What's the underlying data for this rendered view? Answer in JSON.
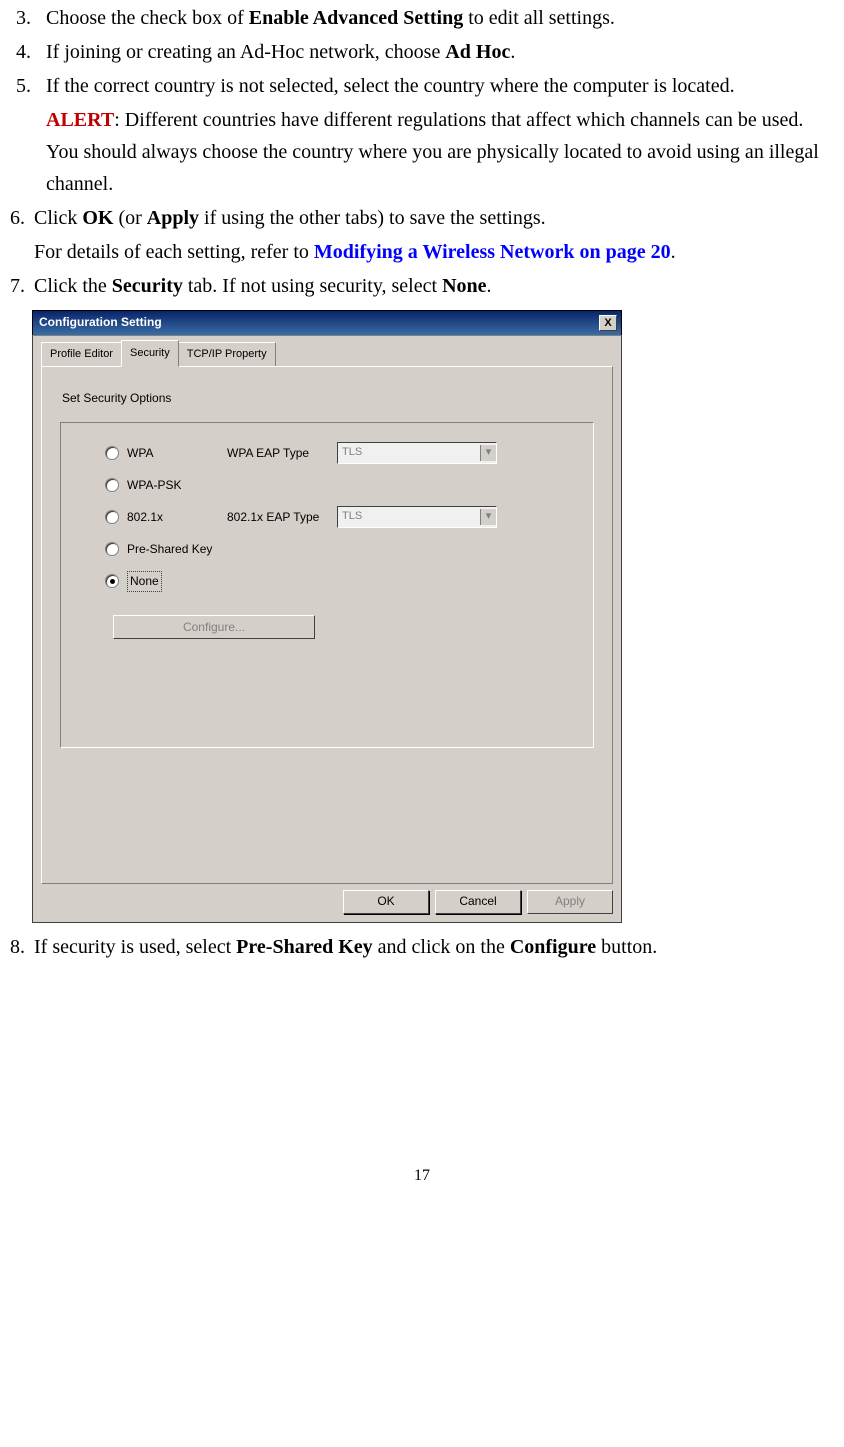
{
  "steps": {
    "s3": {
      "num": "3.",
      "text_before": "Choose the check box of ",
      "bold1": "Enable Advanced Setting",
      "text_after": " to edit all settings."
    },
    "s4": {
      "num": "4.",
      "text_before": "If joining or creating an Ad-Hoc network, choose ",
      "bold1": "Ad Hoc",
      "text_after": "."
    },
    "s5": {
      "num": "5.",
      "line1": "If the correct country is not selected, select the country where the computer is located."
    },
    "alert": {
      "label": "ALERT",
      "text": ": Different countries have different regulations that affect which channels can be used. You should always choose the country where you are physically located to avoid using an illegal channel."
    },
    "s6": {
      "num": "6.",
      "pre": "Click ",
      "bold_ok": "OK",
      "mid1": " (or ",
      "bold_apply": "Apply",
      "mid2": " if using the other tabs) to save the settings."
    },
    "s6b": {
      "pre": "For details of each setting, refer to ",
      "link": "Modifying a Wireless Network on page 20",
      "post": "."
    },
    "s7": {
      "num": "7.",
      "pre": "Click the ",
      "bold_sec": "Security",
      "mid": " tab. If not using security, select ",
      "bold_none": "None",
      "post": "."
    },
    "s8": {
      "num": "8.",
      "pre": "If security is used, select ",
      "bold_psk": "Pre-Shared Key",
      "mid": " and click on the ",
      "bold_conf": "Configure",
      "post": " button."
    }
  },
  "dialog": {
    "title": "Configuration Setting",
    "close_x": "X",
    "tabs": {
      "t1": "Profile Editor",
      "t2": "Security",
      "t3": "TCP/IP Property"
    },
    "group": "Set Security Options",
    "options": {
      "wpa": "WPA",
      "wpa_eap": "WPA EAP Type",
      "wpapsk": "WPA-PSK",
      "dot1x": "802.1x",
      "dot1x_eap": "802.1x EAP Type",
      "psk": "Pre-Shared Key",
      "none": "None",
      "tls": "TLS"
    },
    "configure": "Configure...",
    "ok": "OK",
    "cancel": "Cancel",
    "apply": "Apply"
  },
  "page_number": "17"
}
